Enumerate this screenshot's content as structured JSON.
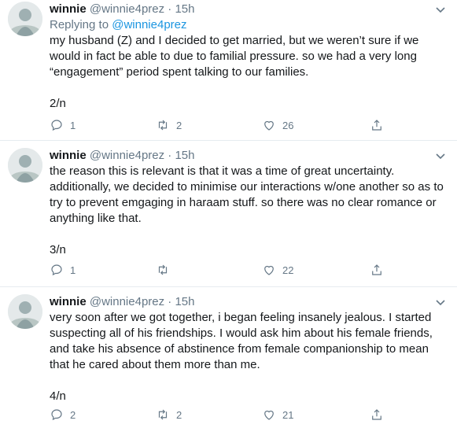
{
  "tweets": [
    {
      "name": "winnie",
      "handle": "@winnie4prez",
      "sep": "·",
      "time": "15h",
      "replying_prefix": "Replying to ",
      "replying_to": "@winnie4prez",
      "lines": [
        "my husband (Z) and I decided to get married, but we weren’t sure if we",
        "would in fact be able to due to familial pressure. so we had a very long",
        "“engagement” period spent talking to our families."
      ],
      "counter": "2/n",
      "reply_count": "1",
      "retweet_count": "2",
      "like_count": "26"
    },
    {
      "name": "winnie",
      "handle": "@winnie4prez",
      "sep": "·",
      "time": "15h",
      "lines": [
        "the reason this is relevant is that it was a time of great uncertainty.",
        "additionally, we decided to minimise our interactions w/one another so as to",
        "try to prevent emgaging in haraam stuff. so there was no clear romance or",
        "anything like that."
      ],
      "counter": "3/n",
      "reply_count": "1",
      "retweet_count": "",
      "like_count": "22"
    },
    {
      "name": "winnie",
      "handle": "@winnie4prez",
      "sep": "·",
      "time": "15h",
      "lines": [
        "very soon after we got together, i began feeling insanely jealous. I started",
        "suspecting all of his friendships. I would ask him about his female friends,",
        "and take his absence of abstinence from female companionship to mean",
        "that he cared about them more than me."
      ],
      "counter": "4/n",
      "reply_count": "2",
      "retweet_count": "2",
      "like_count": "21"
    }
  ],
  "icons": {
    "reply": "reply-icon",
    "retweet": "retweet-icon",
    "like": "like-icon",
    "share": "share-icon",
    "caret": "chevron-down-icon"
  },
  "colors": {
    "secondary_text": "#657786",
    "link": "#1b95e0",
    "divider": "#e6ecf0"
  }
}
